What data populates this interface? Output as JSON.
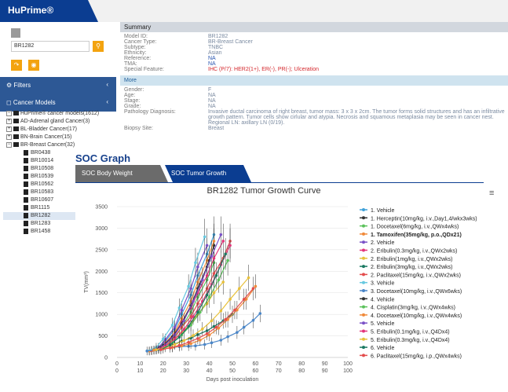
{
  "app": {
    "brand": "HuPrime®"
  },
  "sidebar": {
    "search_value": "BR1282",
    "filters_label": "Filters",
    "cancer_models_label": "Cancer Models",
    "tree": [
      {
        "t": "HuPrime® cancer models(1612)",
        "lvl": 0,
        "tog": "−",
        "type": "fold"
      },
      {
        "t": "AD-Adrenal gland Cancer(3)",
        "lvl": 1,
        "tog": "+",
        "type": "fold"
      },
      {
        "t": "BL-Bladder Cancer(17)",
        "lvl": 1,
        "tog": "+",
        "type": "fold"
      },
      {
        "t": "BN-Brain Cancer(15)",
        "lvl": 1,
        "tog": "+",
        "type": "fold"
      },
      {
        "t": "BR-Breast Cancer(32)",
        "lvl": 1,
        "tog": "−",
        "type": "fold"
      },
      {
        "t": "BR0438",
        "lvl": 2,
        "type": "file"
      },
      {
        "t": "BR10014",
        "lvl": 2,
        "type": "file"
      },
      {
        "t": "BR10508",
        "lvl": 2,
        "type": "file"
      },
      {
        "t": "BR10539",
        "lvl": 2,
        "type": "file"
      },
      {
        "t": "BR10562",
        "lvl": 2,
        "type": "file"
      },
      {
        "t": "BR10583",
        "lvl": 2,
        "type": "file"
      },
      {
        "t": "BR10607",
        "lvl": 2,
        "type": "file"
      },
      {
        "t": "BR1115",
        "lvl": 2,
        "type": "file"
      },
      {
        "t": "BR1282",
        "lvl": 2,
        "type": "file",
        "selected": true
      },
      {
        "t": "BR1283",
        "lvl": 2,
        "type": "file"
      },
      {
        "t": "BR1458",
        "lvl": 2,
        "type": "file"
      }
    ]
  },
  "summary": {
    "title": "Summary",
    "rows": [
      {
        "k": "Model ID:",
        "v": "BR1282",
        "c": ""
      },
      {
        "k": "Cancer Type:",
        "v": "BR-Breast Cancer",
        "c": ""
      },
      {
        "k": "Subtype:",
        "v": "TNBC",
        "c": ""
      },
      {
        "k": "Ethnicity:",
        "v": "Asian",
        "c": ""
      },
      {
        "k": "Reference:",
        "v": "NA",
        "c": "b"
      },
      {
        "k": "TMA:",
        "v": "NA",
        "c": "b"
      },
      {
        "k": "Special Feature:",
        "v": "IHC (P/7): HER2(1+), ER(-), PR(-); Ulceration",
        "c": "r"
      }
    ],
    "more_title": "More",
    "more_rows": [
      {
        "k": "Gender:",
        "v": "F",
        "c": ""
      },
      {
        "k": "Age:",
        "v": "NA",
        "c": ""
      },
      {
        "k": "Stage:",
        "v": "NA",
        "c": ""
      },
      {
        "k": "Grade:",
        "v": "NA",
        "c": ""
      },
      {
        "k": "Pathology Diagnosis:",
        "v": "Invasive ductal carcinoma of right breast, tumor mass: 3 x 3 x 2cm. The tumor forms solid structures and has an infiltrative growth pattern. Tumor cells show cirlular and atypia. Necrosis and squamous metaplasia may be seen in cancer nest. Regional LN: axillary LN (0/19).",
        "c": ""
      },
      {
        "k": "Biopsy Site:",
        "v": "Breast",
        "c": ""
      }
    ]
  },
  "soc": {
    "title": "SOC Graph",
    "tab_body_weight": "SOC Body Weight",
    "tab_tumor_growth": "SOC Tumor Growth"
  },
  "chart_data": {
    "type": "line",
    "title": "BR1282 Tumor Growth Curve",
    "xlabel": "Days post inoculation",
    "ylabel": "TV(mm³)",
    "xlim": [
      0,
      100
    ],
    "ylim": [
      0,
      3500
    ],
    "xticks": [
      0,
      10,
      20,
      30,
      40,
      50,
      60,
      70,
      80,
      90,
      100
    ],
    "yticks": [
      0,
      500,
      1000,
      1500,
      2000,
      2500,
      3000,
      3500
    ],
    "legend_position": "right",
    "series": [
      {
        "name": "1. Vehicle",
        "color": "#3fa0d8",
        "x": [
          14,
          18,
          21,
          25,
          28,
          32,
          35,
          39,
          42
        ],
        "y": [
          150,
          220,
          380,
          650,
          1000,
          1450,
          1900,
          2400,
          2850
        ]
      },
      {
        "name": "1. Herceptin(10mg/kg, i.v.,Day1,4/wkx3wks)",
        "color": "#333333",
        "x": [
          14,
          18,
          21,
          25,
          28,
          32,
          35,
          39,
          42
        ],
        "y": [
          150,
          200,
          320,
          520,
          800,
          1200,
          1600,
          2100,
          2600
        ]
      },
      {
        "name": "1. Docetaxel(6mg/kg, i.v.,QWx4wks)",
        "color": "#5bc25b",
        "x": [
          14,
          18,
          21,
          25,
          28,
          32,
          35,
          39,
          42
        ],
        "y": [
          150,
          190,
          280,
          450,
          700,
          1050,
          1400,
          1800,
          2200
        ]
      },
      {
        "name": "1. Tamoxifen(35mg/kg, p.o.,QDx21)",
        "color": "#f08a3a",
        "x": [
          14,
          18,
          21,
          25,
          28,
          32,
          35,
          39,
          42
        ],
        "y": [
          150,
          210,
          340,
          580,
          900,
          1300,
          1750,
          2250,
          2700
        ]
      },
      {
        "name": "2. Vehicle",
        "color": "#7b52c8",
        "x": [
          15,
          18,
          21,
          25,
          28,
          32,
          35,
          39
        ],
        "y": [
          160,
          230,
          420,
          700,
          1100,
          1600,
          2100,
          2600
        ]
      },
      {
        "name": "2. Eribulin(0.3mg/kg, i.v.,QWx2wks)",
        "color": "#e3357a",
        "x": [
          15,
          18,
          21,
          25,
          28,
          32,
          35,
          39,
          42,
          46
        ],
        "y": [
          160,
          210,
          330,
          540,
          820,
          1150,
          1500,
          1900,
          2300,
          2700
        ]
      },
      {
        "name": "2. Eribulin(1mg/kg, i.v.,QWx2wks)",
        "color": "#e8c13a",
        "x": [
          15,
          18,
          21,
          25,
          28,
          32,
          35,
          39,
          42,
          46
        ],
        "y": [
          160,
          200,
          290,
          420,
          580,
          780,
          1000,
          1250,
          1500,
          1750
        ]
      },
      {
        "name": "2. Eribulin(3mg/kg, i.v.,QWx2wks)",
        "color": "#1b7a62",
        "x": [
          15,
          18,
          21,
          25,
          28,
          32,
          35,
          39,
          42,
          46,
          50
        ],
        "y": [
          160,
          190,
          240,
          310,
          380,
          450,
          530,
          620,
          720,
          850,
          1000
        ]
      },
      {
        "name": "2. Paclitaxel(15mg/kg, i.v.,QWx2wks)",
        "color": "#e34d4d",
        "x": [
          15,
          18,
          21,
          25,
          28,
          32,
          35,
          39,
          42,
          46,
          49
        ],
        "y": [
          160,
          205,
          310,
          480,
          700,
          950,
          1250,
          1600,
          1950,
          2300,
          2700
        ]
      },
      {
        "name": "3. Vehicle",
        "color": "#67c9e0",
        "x": [
          13,
          17,
          20,
          24,
          27,
          31,
          34,
          38
        ],
        "y": [
          150,
          230,
          430,
          750,
          1150,
          1650,
          2200,
          2800
        ]
      },
      {
        "name": "3. Docetaxel(10mg/kg, i.v.,QWx6wks)",
        "color": "#4a86c8",
        "x": [
          13,
          17,
          20,
          24,
          27,
          31,
          34,
          38,
          41,
          45,
          48,
          52,
          55,
          59,
          62
        ],
        "y": [
          150,
          170,
          200,
          230,
          250,
          260,
          270,
          300,
          340,
          400,
          480,
          580,
          700,
          860,
          1020
        ]
      },
      {
        "name": "4. Vehicle",
        "color": "#333333",
        "x": [
          16,
          20,
          24,
          28,
          32,
          36,
          40
        ],
        "y": [
          170,
          280,
          480,
          780,
          1200,
          1700,
          2250
        ]
      },
      {
        "name": "4. Cisplatin(3mg/kg, i.v.,QWx4wks)",
        "color": "#5bc25b",
        "x": [
          16,
          20,
          24,
          28,
          32,
          36,
          40,
          44,
          48
        ],
        "y": [
          170,
          240,
          350,
          520,
          750,
          1050,
          1400,
          1800,
          2250
        ]
      },
      {
        "name": "4. Docetaxel(10mg/kg, i.v.,QWx4wks)",
        "color": "#f08a3a",
        "x": [
          16,
          20,
          24,
          28,
          32,
          36,
          40,
          44,
          48,
          52,
          56,
          60
        ],
        "y": [
          170,
          200,
          230,
          270,
          320,
          400,
          520,
          680,
          880,
          1100,
          1350,
          1650
        ]
      },
      {
        "name": "5. Vehicle",
        "color": "#7b52c8",
        "x": [
          17,
          21,
          25,
          29,
          33,
          37,
          41,
          45
        ],
        "y": [
          180,
          300,
          520,
          850,
          1300,
          1800,
          2350,
          2850
        ]
      },
      {
        "name": "5. Eribulin(0.1mg/kg, i.v.,Q4Dx4)",
        "color": "#e3357a",
        "x": [
          17,
          21,
          25,
          29,
          33,
          37,
          41,
          45,
          49
        ],
        "y": [
          180,
          270,
          420,
          650,
          950,
          1300,
          1700,
          2150,
          2600
        ]
      },
      {
        "name": "5. Eribulin(0.3mg/kg, i.v.,Q4Dx4)",
        "color": "#e8c13a",
        "x": [
          17,
          21,
          25,
          29,
          33,
          37,
          41,
          45,
          49,
          53,
          57
        ],
        "y": [
          180,
          230,
          300,
          390,
          510,
          660,
          850,
          1080,
          1350,
          1600,
          1850
        ]
      },
      {
        "name": "6. Vehicle",
        "color": "#1b7a62",
        "x": [
          19,
          23,
          27,
          31,
          35,
          39,
          43,
          47
        ],
        "y": [
          180,
          290,
          470,
          720,
          1050,
          1450,
          1900,
          2400
        ]
      },
      {
        "name": "6. Paclitaxel(15mg/kg, i.p.,QWx4wks)",
        "color": "#e34d4d",
        "x": [
          19,
          23,
          27,
          31,
          35,
          39,
          43,
          47,
          51,
          55,
          59
        ],
        "y": [
          180,
          220,
          280,
          350,
          440,
          550,
          700,
          880,
          1100,
          1350,
          1600
        ]
      }
    ]
  }
}
